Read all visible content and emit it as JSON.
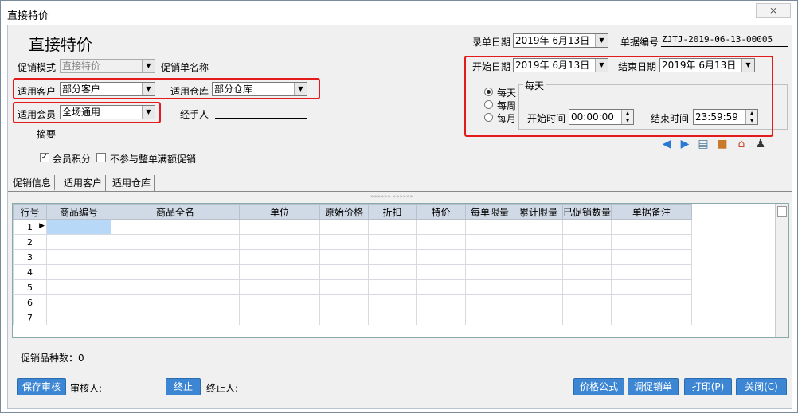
{
  "window": {
    "title": "直接特价",
    "close": "⨯"
  },
  "form": {
    "heading": "直接特价",
    "mode_label": "促销模式",
    "mode_value": "直接特价",
    "name_label": "促销单名称",
    "customer_label": "适用客户",
    "customer_value": "部分客户",
    "warehouse_label": "适用仓库",
    "warehouse_value": "部分仓库",
    "member_label": "适用会员",
    "member_value": "全场通用",
    "handler_label": "经手人",
    "summary_label": "摘要",
    "points_label": "会员积分",
    "exclude_label": "不参与整单满额促销",
    "entry_date_label": "录单日期",
    "entry_date_value": "2019年  6月13日",
    "doc_no_label": "单据编号",
    "doc_no_value": "ZJTJ-2019-06-13-00005",
    "start_date_label": "开始日期",
    "start_date_value": "2019年  6月13日",
    "end_date_label": "结束日期",
    "end_date_value": "2019年  6月13日",
    "freq_daily": "每天",
    "freq_weekly": "每周",
    "freq_monthly": "每月",
    "group_title": "每天",
    "start_time_label": "开始时间",
    "start_time_value": "00:00:00",
    "end_time_label": "结束时间",
    "end_time_value": "23:59:59"
  },
  "tabs": [
    "促销信息",
    "适用客户",
    "适用仓库"
  ],
  "grid": {
    "splitter": "»»»»»»  »»»»»»",
    "columns": [
      "行号",
      "商品编号",
      "商品全名",
      "单位",
      "原始价格",
      "折扣",
      "特价",
      "每单限量",
      "累计限量",
      "已促销数量",
      "单据备注"
    ],
    "rows": [
      "1",
      "2",
      "3",
      "4",
      "5",
      "6",
      "7"
    ]
  },
  "footer": {
    "count_label": "促销品种数：0",
    "save_btn": "保存审核",
    "auditor_label": "审核人:",
    "stop_btn": "终止",
    "stopper_label": "终止人:",
    "price_btn": "价格公式",
    "adjust_btn": "调促销单",
    "print_btn": "打印(P)",
    "close_btn": "关闭(C)"
  },
  "colors": {
    "accent": "#3c86d4",
    "highlight": "#e41b1b",
    "header": "#d0dae6"
  }
}
